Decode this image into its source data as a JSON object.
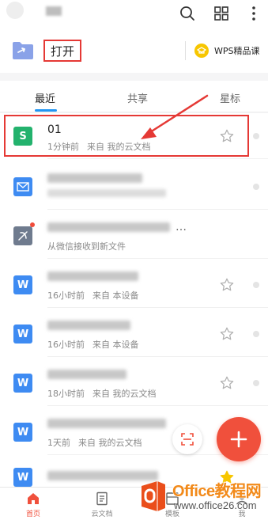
{
  "quick_actions": {
    "open_label": "打开",
    "wps_course_label": "WPS精品课"
  },
  "tabs": [
    {
      "label": "最近",
      "active": true
    },
    {
      "label": "共享",
      "active": false
    },
    {
      "label": "星标",
      "active": false
    }
  ],
  "files": [
    {
      "icon": "wps-sheet-icon",
      "name": "01",
      "time": "1分钟前",
      "source": "来自 我的云文档",
      "starred": false
    },
    {
      "icon": "mail-file-icon",
      "name": "",
      "time": "",
      "source": "",
      "starred": false
    },
    {
      "icon": "pdf-file-icon",
      "name": "",
      "time": "",
      "source": "从微信接收到新文件",
      "starred": false,
      "unread": true
    },
    {
      "icon": "word-file-icon",
      "name": "",
      "time": "16小时前",
      "source": "来自 本设备",
      "starred": false
    },
    {
      "icon": "word-file-icon",
      "name": "",
      "time": "16小时前",
      "source": "来自 本设备",
      "starred": false
    },
    {
      "icon": "word-file-icon",
      "name": "",
      "time": "18小时前",
      "source": "来自 我的云文档",
      "starred": false
    },
    {
      "icon": "word-file-icon",
      "name": "",
      "time": "1天前",
      "source": "来自 我的云文档",
      "starred": false
    }
  ],
  "bottom_nav": [
    {
      "label": "首页",
      "active": true
    },
    {
      "label": "云文档",
      "active": false
    },
    {
      "label": "模板",
      "active": false
    },
    {
      "label": "我",
      "active": false
    }
  ],
  "watermark": {
    "title": "Office教程网",
    "url": "www.office26.com"
  },
  "colors": {
    "accent_blue": "#2196f3",
    "fab_red": "#f0503c",
    "annotation_red": "#e53935",
    "sheet_green": "#23b26d",
    "word_blue": "#3e8bf2"
  }
}
